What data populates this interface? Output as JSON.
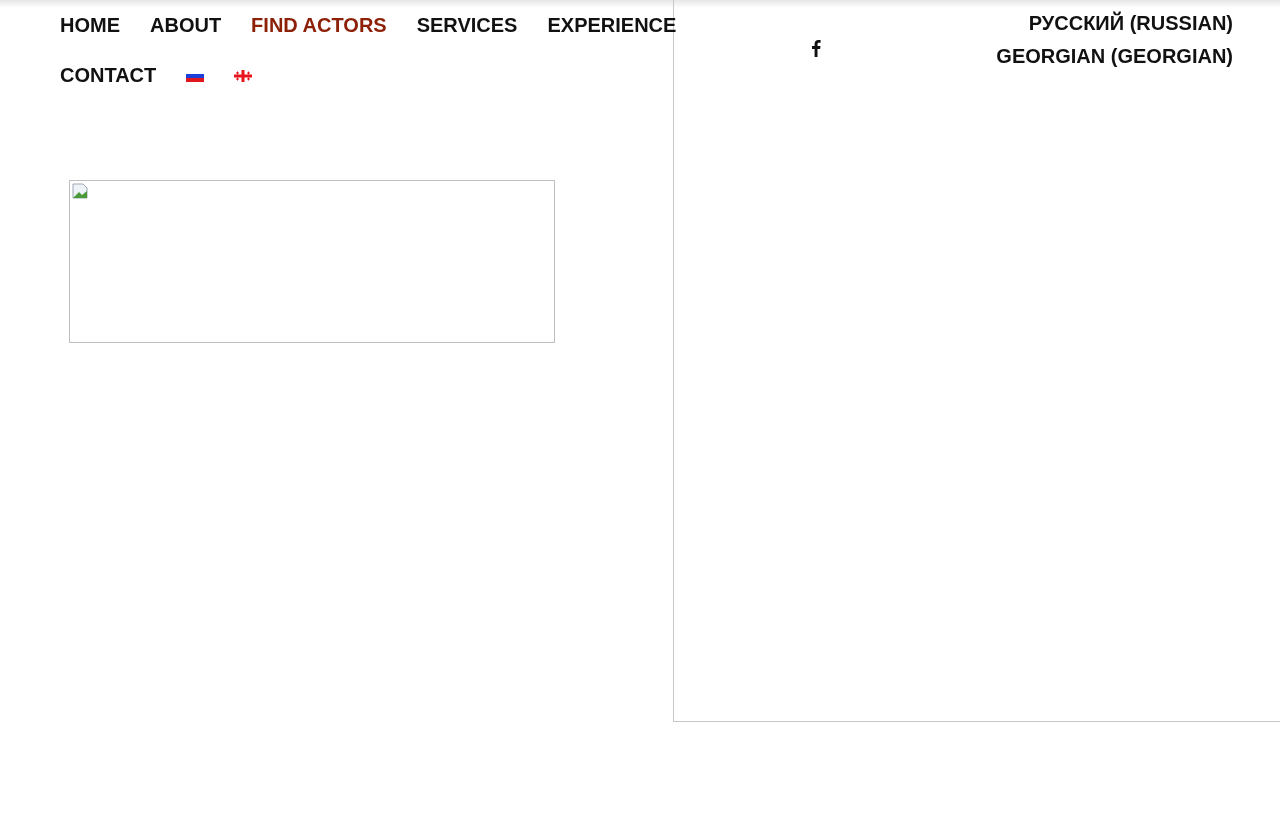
{
  "nav": {
    "items": [
      {
        "label": "HOME",
        "selected": false
      },
      {
        "label": "ABOUT",
        "selected": false
      },
      {
        "label": "FIND ACTORS",
        "selected": true
      },
      {
        "label": "SERVICES",
        "selected": false
      },
      {
        "label": "EXPERIENCE",
        "selected": false
      },
      {
        "label": "CONTACT",
        "selected": false
      }
    ],
    "flags": [
      {
        "kind": "russia"
      },
      {
        "kind": "georgia"
      }
    ]
  },
  "languages": [
    {
      "label": "РУССКИЙ (RUSSIAN)"
    },
    {
      "label": "GEORGIAN (GEORGIAN)"
    }
  ]
}
